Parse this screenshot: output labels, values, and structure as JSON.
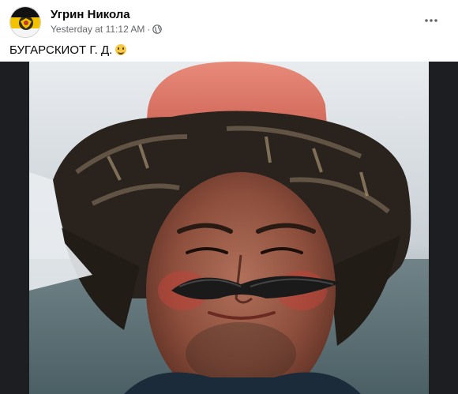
{
  "post": {
    "author_name": "Угрин Никола",
    "timestamp": "Yesterday at 11:12 AM",
    "separator": "·",
    "audience_icon": "globe-icon",
    "more_icon": "more-options-icon",
    "text": "БУГАРСКИОТ Г. Д.",
    "emoji": "grinning-face-emoji"
  },
  "colors": {
    "author": "#050505",
    "meta": "#65676b",
    "photo_frame": "#1c1e21"
  }
}
